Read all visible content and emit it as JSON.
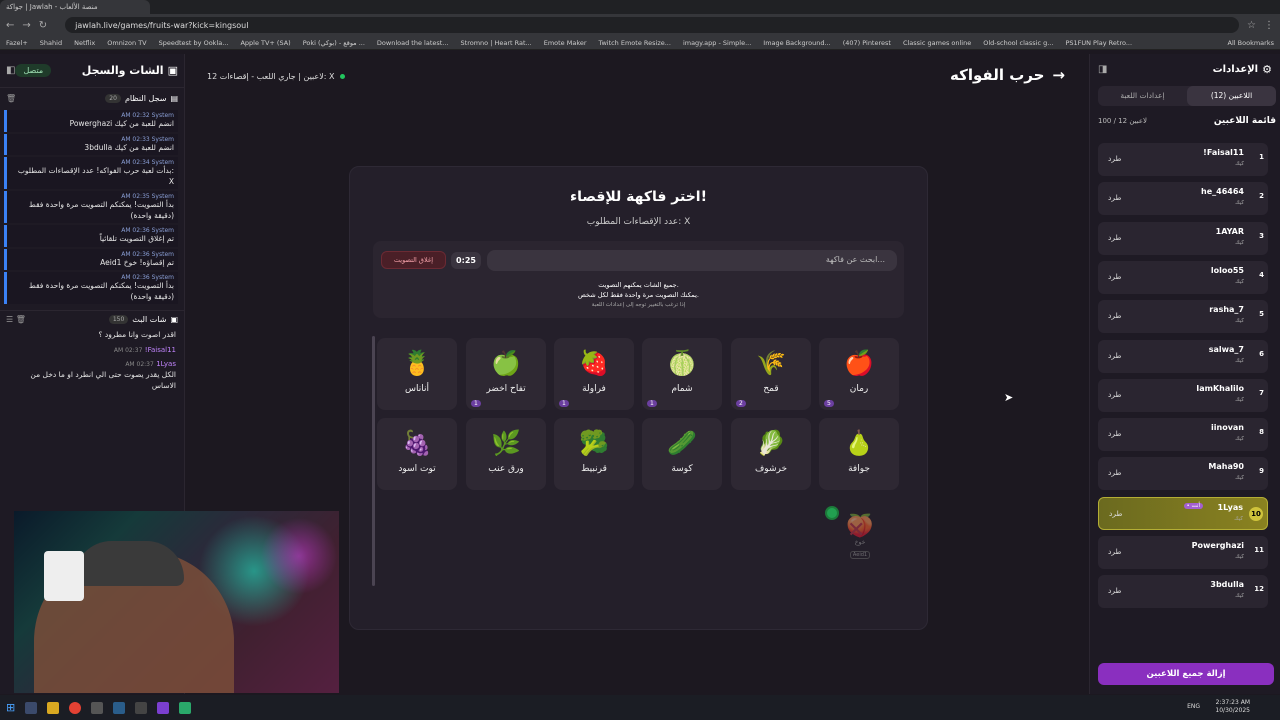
{
  "browser": {
    "tab_title": "جواكة | Jawlah - منصة الألعاب",
    "url": "jawlah.live/games/fruits-war?kick=kingsoul",
    "bookmarks": [
      "Fazel+",
      "Shahid",
      "Netflix",
      "Omnizon TV",
      "Speedtest by Ookla...",
      "Apple TV+ (SA)",
      "Poki (بوكي) - موقع ...",
      "Download the latest...",
      "Stromno | Heart Rat...",
      "Emote Maker",
      "Twitch Emote Resize...",
      "imagy.app - Simple...",
      "Image Background...",
      "(407) Pinterest",
      "Classic games online",
      "Old-school classic g...",
      "PS1FUN Play Retro..."
    ],
    "all_bookmarks": "All Bookmarks"
  },
  "left": {
    "title": "الشات والسجل",
    "online": "متصل",
    "syslog_title": "سجل النظام",
    "syslog_count": "20",
    "entries": [
      {
        "time": "AM 02:32",
        "sender": "System",
        "msg": "Powerghazi انضم للعبة من كيك"
      },
      {
        "time": "AM 02:33",
        "sender": "System",
        "msg": "3bdulla انضم للعبة من كيك"
      },
      {
        "time": "AM 02:34",
        "sender": "System",
        "msg": "بدأت لعبة حرب الفواكه! عدد الإقصاءات المطلوب: X"
      },
      {
        "time": "AM 02:35",
        "sender": "System",
        "msg": "بدأ التصويت! يمكنكم التصويت مرة واحدة فقط (دقيقة واحدة)"
      },
      {
        "time": "AM 02:36",
        "sender": "System",
        "msg": "تم إغلاق التصويت تلقائياً"
      },
      {
        "time": "AM 02:36",
        "sender": "System",
        "msg": "Aeid1 تم إقصاؤه! خوخ"
      },
      {
        "time": "AM 02:36",
        "sender": "System",
        "msg": "بدأ التصويت! يمكنكم التصويت مرة واحدة فقط (دقيقة واحدة)"
      }
    ],
    "chat_title": "شات البث",
    "chat_count": "150",
    "chat": [
      {
        "name": "",
        "time": "",
        "msg": "اقدر اصوت وانا مطرود ؟"
      },
      {
        "name": "!Faisal11",
        "time": "AM 02:37",
        "msg": ""
      },
      {
        "name": "1Lyas",
        "time": "AM 02:37",
        "msg": "الكل يقدر يصوت حتى الي انطرد او ما دخل من الاساس"
      }
    ]
  },
  "center": {
    "game_title": "حرب الفواكه",
    "status": "12 لاعبين | جاري اللعب - إقصاءات: X",
    "card_title": "اختر فاكهة للإقصاء!",
    "card_sub": "عدد الإقصاءات المطلوب: X",
    "search_placeholder": "ابحث عن فاكهة...",
    "timer": "0:25",
    "close_vote": "إغلاق التصويت",
    "info1": "جميع الشات يمكنهم التصويت.",
    "info2": "يمكنك التصويت مرة واحدة فقط لكل شخص.",
    "info3": "إذا ترغب بالتغيير توجه إلى إعدادات اللعبة",
    "fruits": [
      {
        "name": "رمان",
        "emoji": "🍎",
        "votes": "5"
      },
      {
        "name": "قمح",
        "emoji": "🌾",
        "votes": "2"
      },
      {
        "name": "شمام",
        "emoji": "🍈",
        "votes": "1"
      },
      {
        "name": "فراولة",
        "emoji": "🍓",
        "votes": "1"
      },
      {
        "name": "تفاح اخضر",
        "emoji": "🍏",
        "votes": "1"
      },
      {
        "name": "أناناس",
        "emoji": "🍍",
        "votes": ""
      },
      {
        "name": "جوافة",
        "emoji": "🍐",
        "votes": ""
      },
      {
        "name": "خرشوف",
        "emoji": "🥬",
        "votes": ""
      },
      {
        "name": "كوسة",
        "emoji": "🥒",
        "votes": ""
      },
      {
        "name": "قرنبيط",
        "emoji": "🥦",
        "votes": ""
      },
      {
        "name": "ورق عنب",
        "emoji": "🌿",
        "votes": ""
      },
      {
        "name": "توت اسود",
        "emoji": "🍇",
        "votes": ""
      }
    ],
    "eliminated_name": "خوخ",
    "eliminated_player": "Aeid1"
  },
  "right": {
    "title": "الإعدادات",
    "tab_players": "اللاعبين (12)",
    "tab_settings": "إعدادات اللعبة",
    "list_title": "قائمة اللاعبين",
    "list_count": "100 / 12 لاعبين",
    "kick_label": "طرد",
    "you_label": "• أنت",
    "meta": "كيك",
    "players": [
      "!Faisal11",
      "he_46464",
      "1AYAR",
      "loloo55",
      "rasha_7",
      "salwa_7",
      "IamKhalilo",
      "iinovan",
      "Maha90",
      "1Lyas",
      "Powerghazi",
      "3bdulla"
    ],
    "remove_all": "إزالة جميع اللاعبين"
  },
  "taskbar": {
    "lang": "ENG",
    "time": "2:37:23 AM",
    "date": "10/30/2025"
  }
}
